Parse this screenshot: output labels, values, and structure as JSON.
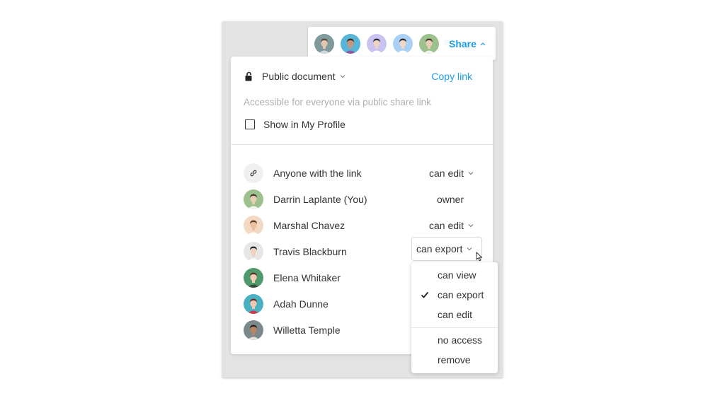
{
  "header": {
    "share_label": "Share",
    "avatars": [
      {
        "name": "collaborator-1",
        "bg": "#7f9a9d",
        "skin": "#e3c6b0",
        "hair": "#5a4a40",
        "shirt": "#cfd9db"
      },
      {
        "name": "collaborator-2",
        "bg": "#57b6d8",
        "skin": "#c9957a",
        "hair": "#3b2a26",
        "shirt": "#8f5aa2"
      },
      {
        "name": "collaborator-3",
        "bg": "#c9c3f2",
        "skin": "#f0d2c0",
        "hair": "#2b2b33",
        "shirt": "#ffffff"
      },
      {
        "name": "collaborator-4",
        "bg": "#a9d1f5",
        "skin": "#f1d8c6",
        "hair": "#2c2c2c",
        "shirt": "#ffffff"
      },
      {
        "name": "collaborator-5",
        "bg": "#9cc18c",
        "skin": "#e9cdb7",
        "hair": "#4a3b2e",
        "shirt": "#f2f2f2"
      }
    ]
  },
  "panel": {
    "visibility_label": "Public document",
    "copy_link_label": "Copy link",
    "description": "Accessible for everyone via public share link",
    "show_profile_label": "Show in My Profile",
    "people": [
      {
        "name": "Anyone with the link",
        "permission": "can edit",
        "dropdown": true,
        "type": "link"
      },
      {
        "name": "Darrin Laplante (You)",
        "permission": "owner",
        "dropdown": false,
        "avatar": {
          "bg": "#9cc18c",
          "skin": "#e9cdb7",
          "hair": "#4a3b2e",
          "shirt": "#f2f2f2"
        }
      },
      {
        "name": "Marshal Chavez",
        "permission": "can edit",
        "dropdown": true,
        "avatar": {
          "bg": "#f3d9c2",
          "skin": "#e9c0a0",
          "hair": "#5c3a2a",
          "shirt": "#ffffff"
        }
      },
      {
        "name": "Travis Blackburn",
        "permission": "can export",
        "dropdown": true,
        "active": true,
        "avatar": {
          "bg": "#e6e6e6",
          "skin": "#efd3c1",
          "hair": "#2c2c2c",
          "shirt": "#ffffff"
        }
      },
      {
        "name": "Elena Whitaker",
        "permission": "",
        "dropdown": false,
        "avatar": {
          "bg": "#4f9a6c",
          "skin": "#f0cdb8",
          "hair": "#5a3424",
          "shirt": "#3a4a3a"
        }
      },
      {
        "name": "Adah Dunne",
        "permission": "",
        "dropdown": false,
        "avatar": {
          "bg": "#4ab1c2",
          "skin": "#f2c9b4",
          "hair": "#6b2e22",
          "shirt": "#d23a4a"
        }
      },
      {
        "name": "Willetta Temple",
        "permission": "",
        "dropdown": false,
        "avatar": {
          "bg": "#7a8a8c",
          "skin": "#b98563",
          "hair": "#2a1e1a",
          "shirt": "#e7e1d6"
        }
      }
    ]
  },
  "permission_menu": {
    "options": [
      "can view",
      "can export",
      "can edit"
    ],
    "selected": "can export",
    "actions": [
      "no access",
      "remove"
    ]
  },
  "colors": {
    "accent": "#1d9ce8",
    "frame_bg": "#e3e3e3",
    "muted_text": "#b0b0b0"
  }
}
